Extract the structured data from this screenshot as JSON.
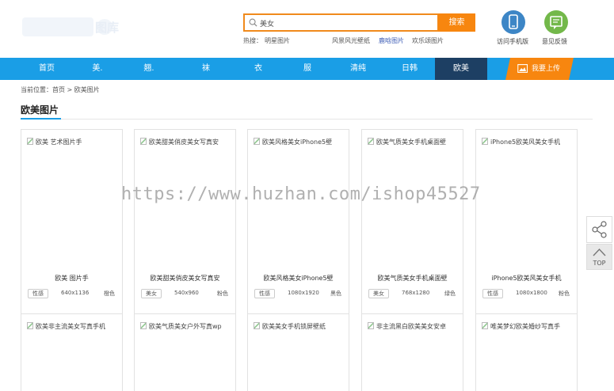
{
  "header": {
    "logo_text": "图库",
    "search": {
      "value": "美女",
      "button": "搜索"
    },
    "hot": {
      "label": "热搜：",
      "items": [
        "明星图片",
        "风景风光壁纸",
        "鹿晗图片",
        "欢乐颂图片"
      ]
    },
    "icons": [
      {
        "label": "访问手机版",
        "icon": "phone-icon",
        "color": "#3d86c6"
      },
      {
        "label": "意见反馈",
        "icon": "feedback-icon",
        "color": "#73b84a"
      }
    ]
  },
  "nav": {
    "items": [
      "首页",
      "美.",
      "翘.",
      "袜",
      "衣",
      "服",
      "清纯",
      "日韩",
      "欧美"
    ],
    "active": "欧美",
    "upload": "我要上传",
    "accent": "#1a9ee6",
    "upload_color": "#f7860f"
  },
  "breadcrumb": {
    "prefix": "当前位置：",
    "home": "首页",
    "sep": " > ",
    "current": "欧美图片"
  },
  "page_title": "欧美图片",
  "cards": [
    {
      "alt": "欧美 艺术图片手",
      "title": "欧美 图片手",
      "tag": "性感",
      "size": "640x1136",
      "color": "橙色"
    },
    {
      "alt": "欧美甜美俏皮美女写真安",
      "title": "欧美甜美俏皮美女写真安",
      "tag": "美女",
      "size": "540x960",
      "color": "粉色"
    },
    {
      "alt": "欧美风格美女iPhone5壁",
      "title": "欧美风格美女iPhone5壁",
      "tag": "性感",
      "size": "1080x1920",
      "color": "黑色"
    },
    {
      "alt": "欧美气质美女手机桌面壁",
      "title": "欧美气质美女手机桌面壁",
      "tag": "美女",
      "size": "768x1280",
      "color": "绿色"
    },
    {
      "alt": "iPhone5欧美风美女手机",
      "title": "iPhone5欧美风美女手机",
      "tag": "性感",
      "size": "1080x1800",
      "color": "粉色"
    }
  ],
  "cards_row2": [
    {
      "alt": "欧美非主流美女写真手机"
    },
    {
      "alt": "欧美气质美女户外写真wp"
    },
    {
      "alt": "欧美美女手机锁屏壁纸"
    },
    {
      "alt": "非主流黑白欧美美女安卓"
    },
    {
      "alt": "唯美梦幻欧美婚纱写真手"
    }
  ],
  "watermark": "https://www.huzhan.com/ishop45527",
  "side": {
    "top_label": "TOP"
  }
}
